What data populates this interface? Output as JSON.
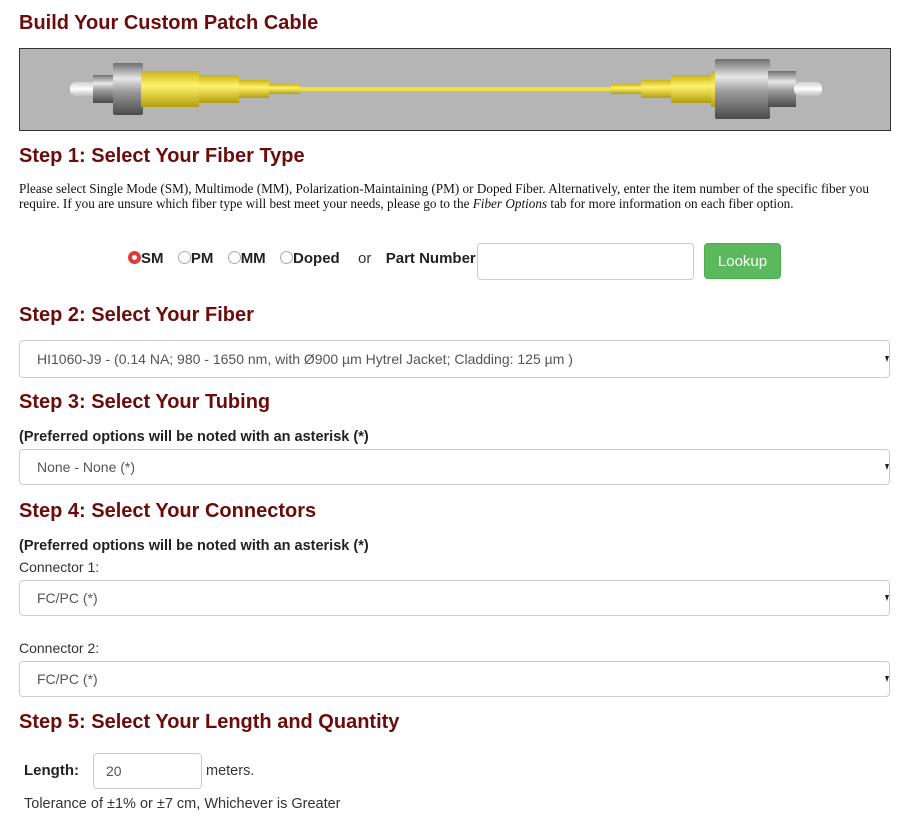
{
  "title": "Build Your Custom Patch Cable",
  "step1": {
    "heading": "Step 1: Select Your Fiber Type",
    "intro_part1": "Please select Single Mode (SM), Multimode (MM), Polarization-Maintaining (PM) or Doped Fiber.  Alternatively, enter the item number of the specific fiber you require.  If you are unsure which fiber type will best meet your needs, please go to the ",
    "intro_link": "Fiber Options",
    "intro_part2": " tab for more information on each fiber option.",
    "options": [
      "SM",
      "PM",
      "MM",
      "Doped"
    ],
    "selected": "SM",
    "or_text": "or",
    "part_number_label": "Part Number:",
    "part_number_value": "",
    "lookup_label": "Lookup"
  },
  "step2": {
    "heading": "Step 2: Select Your Fiber",
    "selected": "HI1060-J9 - (0.14 NA; 980 - 1650 nm, with Ø900 µm Hytrel Jacket; Cladding: 125 µm )"
  },
  "step3": {
    "heading": "Step 3: Select Your Tubing",
    "note": "(Preferred options will be noted with an asterisk (*)",
    "selected": "None - None (*)"
  },
  "step4": {
    "heading": "Step 4: Select Your Connectors",
    "note": "(Preferred options will be noted with an asterisk (*)",
    "connector1_label": "Connector 1:",
    "connector1_selected": "FC/PC (*)",
    "connector2_label": "Connector 2:",
    "connector2_selected": "FC/PC (*)"
  },
  "step5": {
    "heading": "Step 5: Select Your Length and Quantity",
    "length_label": "Length:",
    "length_value": "20",
    "length_unit": "meters.",
    "tolerance": "Tolerance of ±1% or ±7 cm, Whichever is Greater"
  },
  "colors": {
    "heading": "#6b0b0b",
    "radio_selected": "#e03b3b",
    "lookup_button": "#5cb85c",
    "cable_yellow": "#f2e03a",
    "banner_bg": "#b5b5b5"
  }
}
